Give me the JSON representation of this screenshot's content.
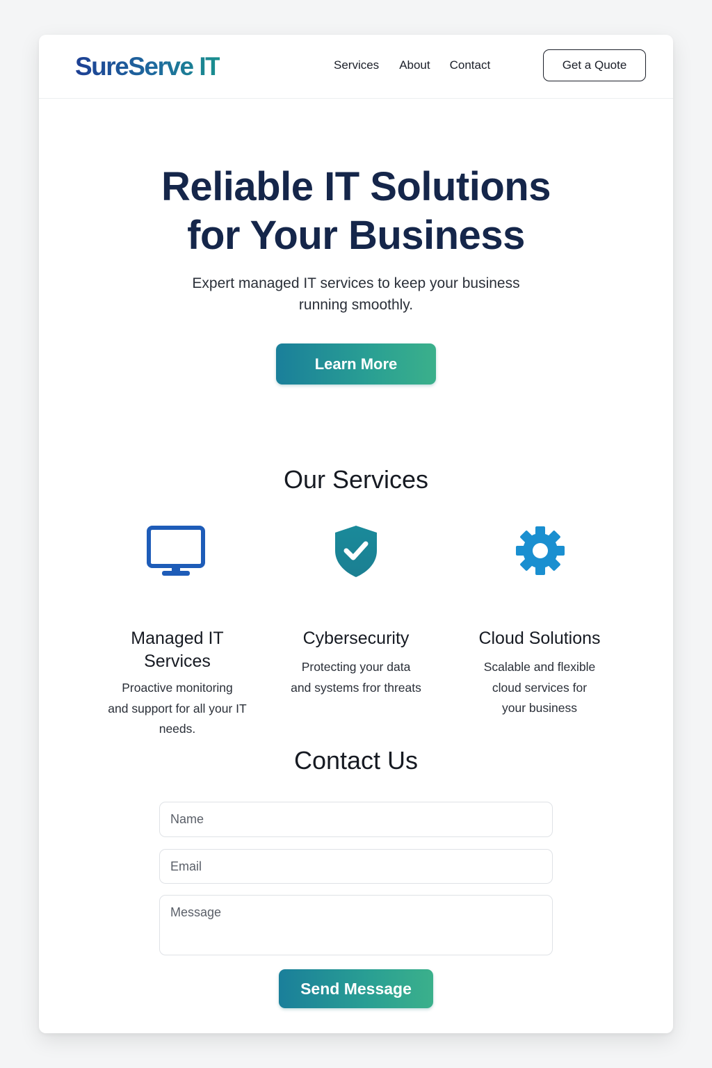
{
  "header": {
    "logo": "SureServe IT",
    "nav": [
      "Services",
      "About",
      "Contact"
    ],
    "cta_label": "Get a Quote"
  },
  "hero": {
    "title_line1": "Reliable IT Solutions",
    "title_line2": "for Your Business",
    "subtitle": "Expert managed IT services to keep your business running smoothly.",
    "button_label": "Learn More"
  },
  "services": {
    "title": "Our Services",
    "items": [
      {
        "icon": "monitor-icon",
        "title_line1": "Managed IT",
        "title_line2": "Services",
        "desc_lines": [
          "Proactive monitoring",
          "and support for all your IT",
          "needs."
        ]
      },
      {
        "icon": "shield-check-icon",
        "title_line1": "Cybersecurity",
        "desc_lines": [
          "Protecting your data",
          "and systems fror threats"
        ]
      },
      {
        "icon": "gear-icon",
        "title_line1": "Cloud Solutions",
        "desc_lines": [
          "Scalable and flexible",
          "cloud services for",
          "your business"
        ]
      }
    ]
  },
  "contact": {
    "title": "Contact Us",
    "name_placeholder": "Name",
    "email_placeholder": "Email",
    "message_placeholder": "Message",
    "button_label": "Send Message"
  },
  "colors": {
    "brand_dark": "#15264a",
    "accent_start": "#1a7f9a",
    "accent_end": "#3bb08b",
    "icon_blue": "#1e5cb8",
    "icon_teal": "#1a8a9a",
    "icon_sky": "#1a8fd0"
  }
}
